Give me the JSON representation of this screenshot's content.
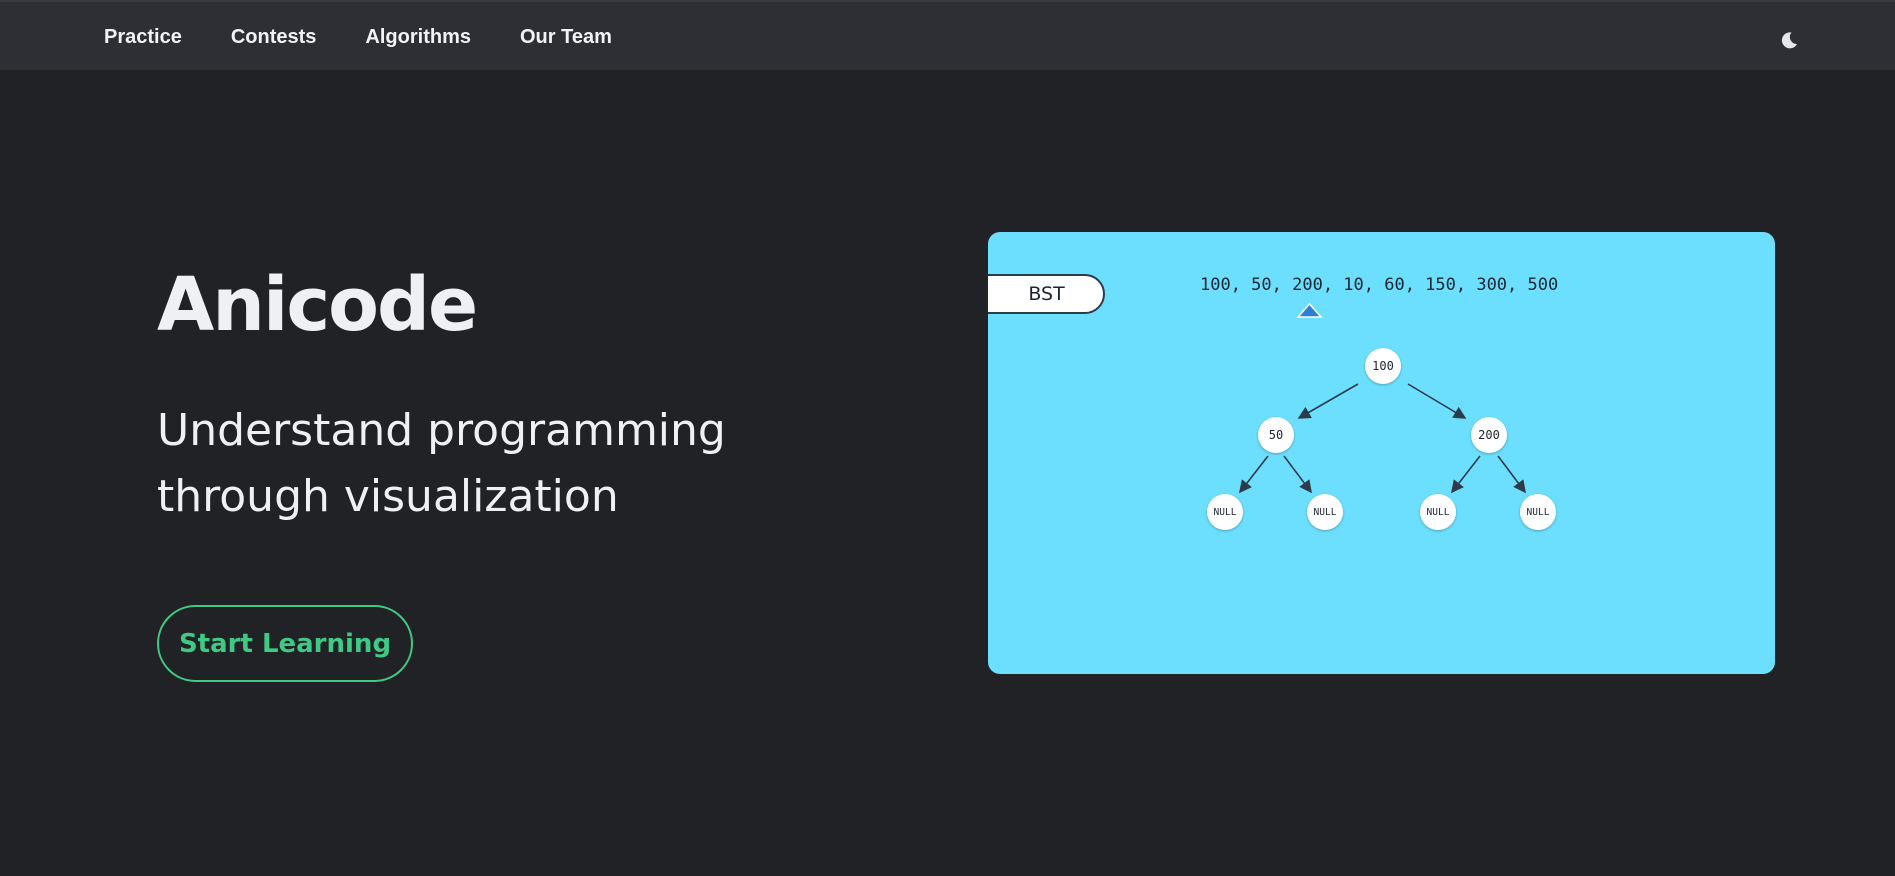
{
  "nav": {
    "items": [
      {
        "label": "Practice"
      },
      {
        "label": "Contests"
      },
      {
        "label": "Algorithms"
      },
      {
        "label": "Our Team"
      }
    ],
    "theme_icon": "moon-icon"
  },
  "hero": {
    "title": "Anicode",
    "subtitle_line1": "Understand programming",
    "subtitle_line2": "through visualization",
    "cta_label": "Start Learning"
  },
  "visualization": {
    "tag": "BST",
    "sequence": "100, 50, 200, 10, 60, 150, 300, 500",
    "current_index": 2,
    "tree": {
      "root": "100",
      "left": "50",
      "right": "200",
      "leaves": [
        "NULL",
        "NULL",
        "NULL",
        "NULL"
      ]
    }
  },
  "colors": {
    "background": "#212226",
    "navbar": "#2e2f35",
    "accent": "#3fc985",
    "panel": "#6cdffe",
    "pointer": "#2b7fd6"
  }
}
